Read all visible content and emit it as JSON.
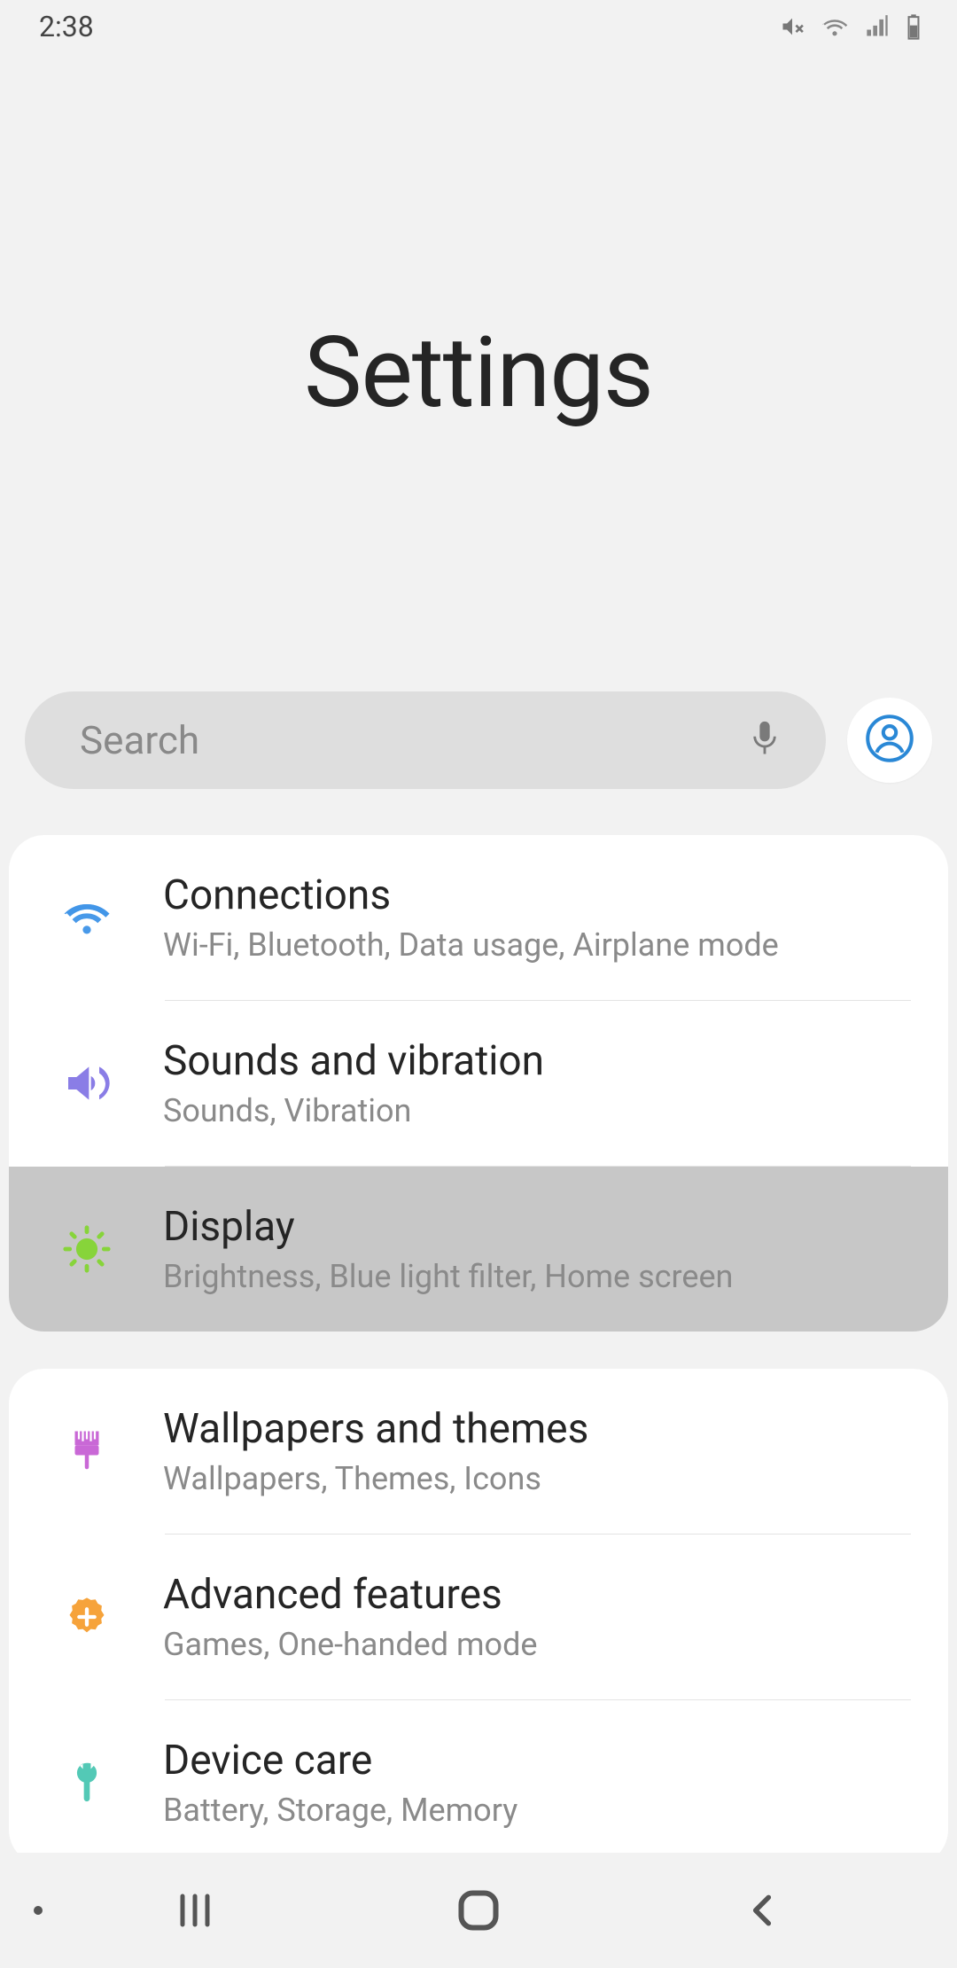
{
  "status": {
    "time": "2:38"
  },
  "header": {
    "title": "Settings"
  },
  "search": {
    "placeholder": "Search"
  },
  "groups": [
    {
      "items": [
        {
          "id": "connections",
          "title": "Connections",
          "sub": "Wi-Fi, Bluetooth, Data usage, Airplane mode",
          "highlighted": false
        },
        {
          "id": "sounds",
          "title": "Sounds and vibration",
          "sub": "Sounds, Vibration",
          "highlighted": false
        },
        {
          "id": "display",
          "title": "Display",
          "sub": "Brightness, Blue light filter, Home screen",
          "highlighted": true
        }
      ]
    },
    {
      "items": [
        {
          "id": "wallpapers",
          "title": "Wallpapers and themes",
          "sub": "Wallpapers, Themes, Icons",
          "highlighted": false
        },
        {
          "id": "advanced",
          "title": "Advanced features",
          "sub": "Games, One-handed mode",
          "highlighted": false
        },
        {
          "id": "devicecare",
          "title": "Device care",
          "sub": "Battery, Storage, Memory",
          "highlighted": false
        }
      ]
    }
  ],
  "colors": {
    "wifi": "#3e94e8",
    "speaker": "#8a7de6",
    "brightness": "#87d43a",
    "brush": "#c968d6",
    "gear": "#f6a33b",
    "wrench": "#53c9b6",
    "profile": "#2a88d6"
  }
}
